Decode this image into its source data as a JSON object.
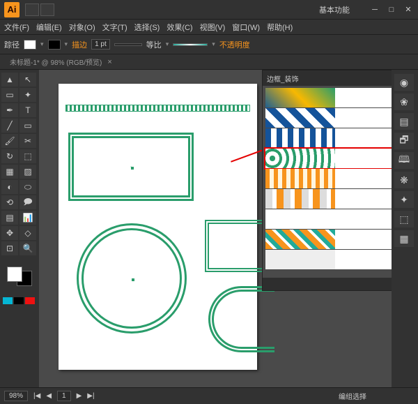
{
  "app_logo": "Ai",
  "workspace_label": "基本功能",
  "window_buttons": {
    "min": "─",
    "max": "□",
    "close": "✕"
  },
  "menu": [
    "文件(F)",
    "编辑(E)",
    "对象(O)",
    "文字(T)",
    "选择(S)",
    "效果(C)",
    "视图(V)",
    "窗口(W)",
    "帮助(H)"
  ],
  "control": {
    "path_label": "踪径",
    "stroke_label": "描边",
    "stroke_value": "1 pt",
    "uniform_label": "等比",
    "opacity_label": "不透明度"
  },
  "tab": {
    "title": "未标题-1* @ 98% (RGB/预览)",
    "close": "×"
  },
  "tools": [
    [
      "▲",
      "↖"
    ],
    [
      "▭",
      "✦"
    ],
    [
      "✒",
      "T"
    ],
    [
      "╱",
      "▭"
    ],
    [
      "🖌",
      "✂"
    ],
    [
      "↻",
      "⬚"
    ],
    [
      "▦",
      "▨"
    ],
    [
      "◐",
      "⬭"
    ],
    [
      "⟲",
      "🗩"
    ],
    [
      "▤",
      "📊"
    ],
    [
      "✥",
      "◇"
    ],
    [
      "⊡",
      "🔍"
    ]
  ],
  "panel": {
    "title": "边框_装饰",
    "menu_icon": "▾"
  },
  "status": {
    "zoom": "98%",
    "page_nav": [
      "|◀",
      "◀",
      "1",
      "▶",
      "▶|"
    ],
    "selection": "编组选择"
  },
  "dock_icons": [
    "◉",
    "❀",
    "▤",
    "🗗",
    "🕮",
    "❋",
    "✦",
    "⬚",
    "▦"
  ]
}
